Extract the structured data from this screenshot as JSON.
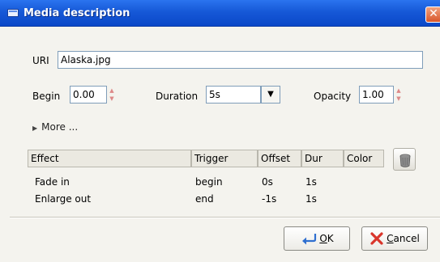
{
  "window": {
    "title": "Media description",
    "close_glyph": "✕"
  },
  "uri": {
    "label": "URI",
    "value": "Alaska.jpg"
  },
  "timing": {
    "begin_label": "Begin",
    "begin_value": "0.00",
    "duration_label": "Duration",
    "duration_value": "5s",
    "opacity_label": "Opacity",
    "opacity_value": "1.00"
  },
  "more": {
    "label": "More ..."
  },
  "effects": {
    "columns": [
      "Effect",
      "Trigger",
      "Offset",
      "Dur",
      "Color"
    ],
    "rows": [
      {
        "effect": "Fade in",
        "trigger": "begin",
        "offset": "0s",
        "dur": "1s",
        "color": ""
      },
      {
        "effect": "Enlarge out",
        "trigger": "end",
        "offset": "-1s",
        "dur": "1s",
        "color": ""
      }
    ]
  },
  "buttons": {
    "ok_mnemonic": "O",
    "ok_rest": "K",
    "cancel_mnemonic": "C",
    "cancel_rest": "ancel"
  },
  "icons": {
    "title": "window-icon",
    "close": "close-icon",
    "spin_up": "spin-up-icon",
    "spin_down": "spin-down-icon",
    "dropdown": "dropdown-arrow-icon",
    "more": "expand-arrow-icon",
    "trash": "trash-icon",
    "ok": "ok-icon",
    "cancel": "cancel-icon"
  },
  "colors": {
    "titlebar": "#1658d7",
    "close": "#d8562b",
    "field_border": "#7f9db9",
    "dialog_bg": "#f4f3ee"
  }
}
